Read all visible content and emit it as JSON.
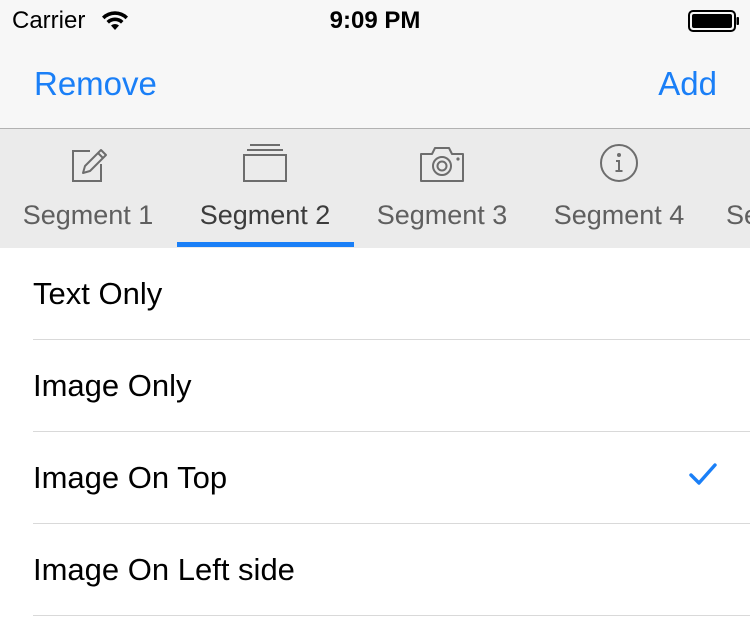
{
  "status_bar": {
    "carrier": "Carrier",
    "time": "9:09 PM",
    "wifi_icon": "wifi-icon",
    "battery_icon": "battery-icon"
  },
  "nav_bar": {
    "left_button": "Remove",
    "right_button": "Add"
  },
  "segments": [
    {
      "label": "Segment 1",
      "icon": "compose-icon",
      "selected": false
    },
    {
      "label": "Segment 2",
      "icon": "stack-icon",
      "selected": true
    },
    {
      "label": "Segment 3",
      "icon": "camera-icon",
      "selected": false
    },
    {
      "label": "Segment 4",
      "icon": "info-icon",
      "selected": false
    },
    {
      "label": "Se",
      "icon": "",
      "selected": false
    }
  ],
  "options": [
    {
      "label": "Text Only",
      "checked": false
    },
    {
      "label": "Image Only",
      "checked": false
    },
    {
      "label": "Image On Top",
      "checked": true
    },
    {
      "label": "Image On Left side",
      "checked": false
    }
  ],
  "colors": {
    "accent": "#1a7ff7",
    "bar_background": "#f7f7f7",
    "segment_background": "#ebebeb",
    "separator": "#d9d9d9"
  }
}
